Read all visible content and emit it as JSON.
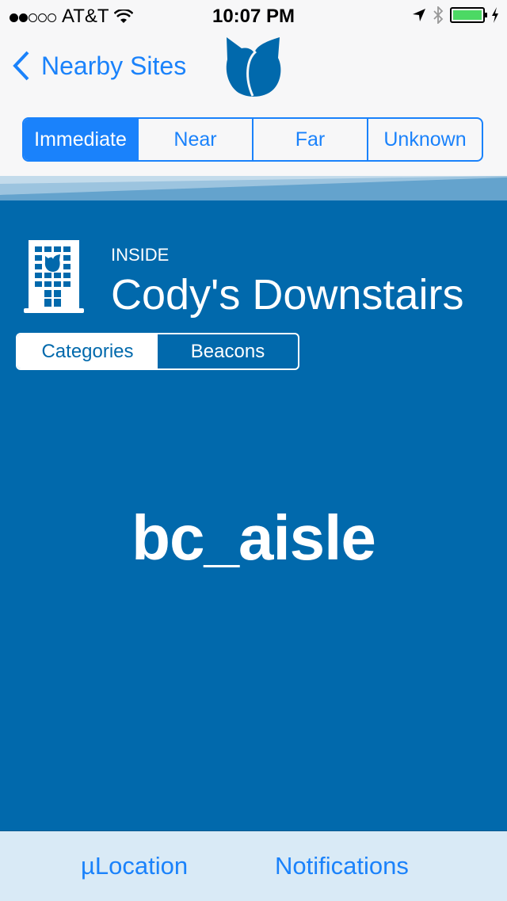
{
  "status_bar": {
    "signal_dots_filled": 2,
    "signal_dots_total": 5,
    "carrier": "AT&T",
    "time": "10:07 PM",
    "battery_level": 1.0,
    "icons": [
      "wifi-icon",
      "location-arrow-icon",
      "bluetooth-icon",
      "battery-icon",
      "charging-bolt-icon"
    ]
  },
  "nav": {
    "back_label": "Nearby Sites",
    "logo": "tulip-logo-icon"
  },
  "proximity_segments": {
    "items": [
      "Immediate",
      "Near",
      "Far",
      "Unknown"
    ],
    "selected": "Immediate"
  },
  "site": {
    "status_label": "INSIDE",
    "name": "Cody's Downstairs",
    "icon": "building-icon"
  },
  "view_segments": {
    "items": [
      "Categories",
      "Beacons"
    ],
    "selected": "Categories"
  },
  "beacon": {
    "name": "bc_aisle"
  },
  "tab_bar": {
    "items": [
      "µLocation",
      "Notifications"
    ]
  },
  "colors": {
    "accent": "#1a82fb",
    "brand_blue": "#0169ac",
    "tab_bar_bg": "#d9eaf6"
  }
}
